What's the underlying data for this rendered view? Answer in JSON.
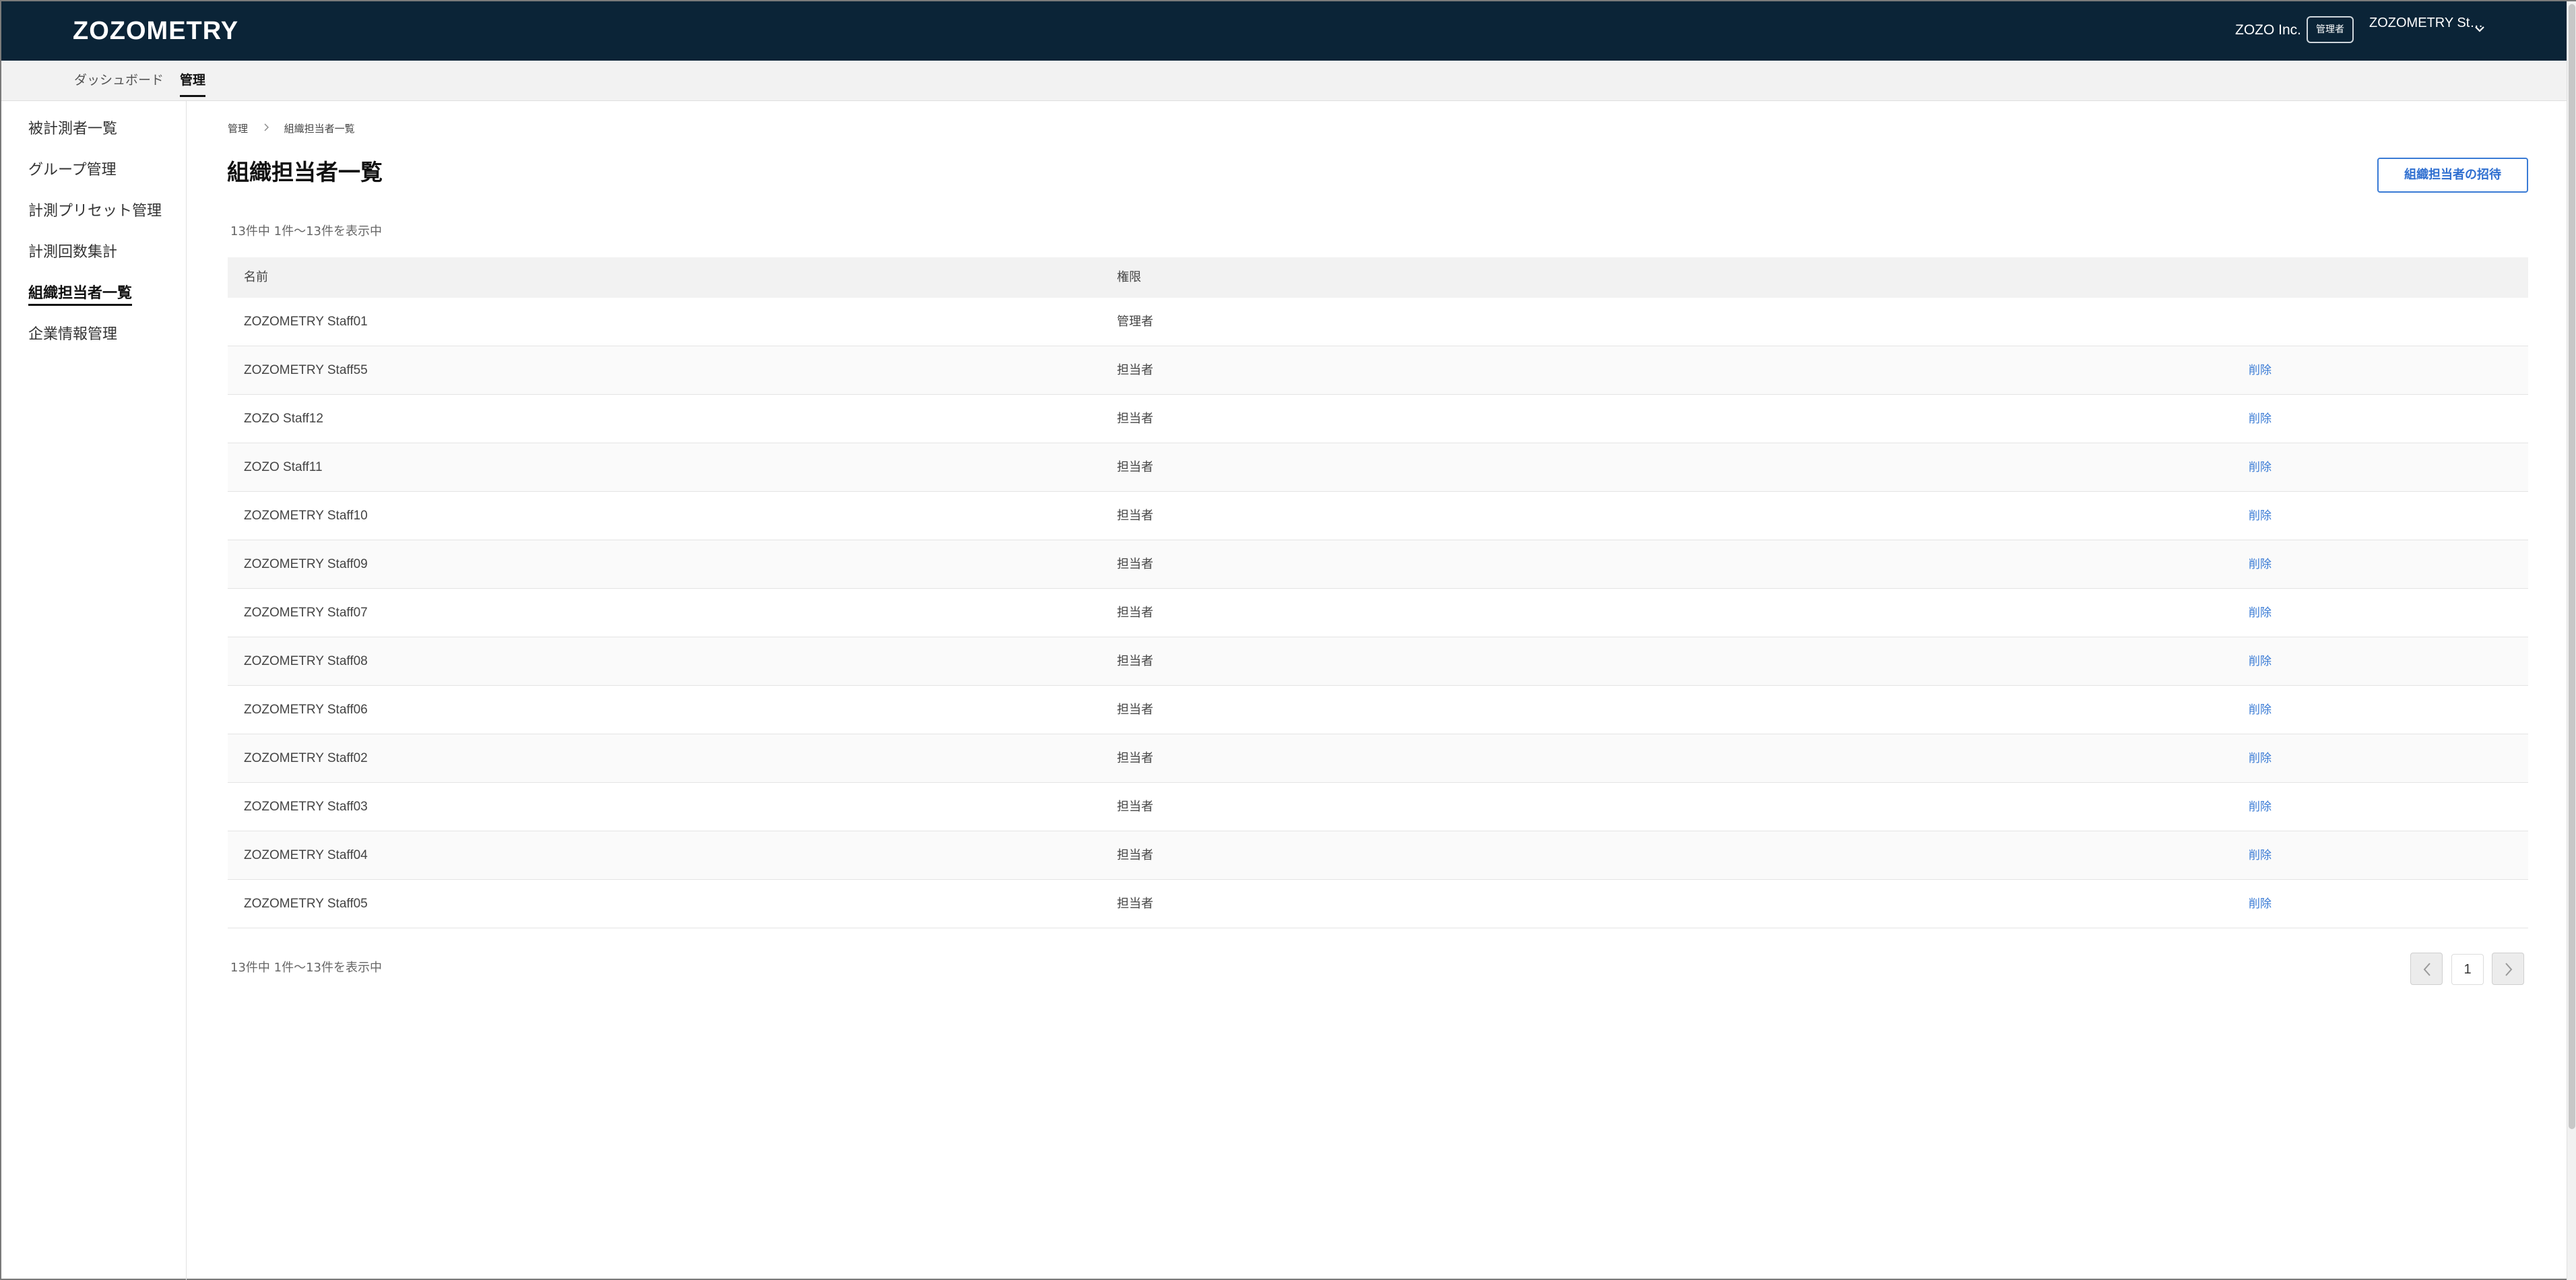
{
  "header": {
    "logo": "ZOZOMETRY",
    "company": "ZOZO Inc.",
    "role_badge": "管理者",
    "user_name": "ZOZOMETRY St…"
  },
  "subnav": {
    "dashboard": "ダッシュボード",
    "admin": "管理"
  },
  "sidebar": {
    "items": [
      {
        "label": "被計測者一覧"
      },
      {
        "label": "グループ管理"
      },
      {
        "label": "計測プリセット管理"
      },
      {
        "label": "計測回数集計"
      },
      {
        "label": "組織担当者一覧",
        "active": true
      },
      {
        "label": "企業情報管理"
      }
    ]
  },
  "breadcrumb": {
    "root": "管理",
    "current": "組織担当者一覧"
  },
  "page": {
    "title": "組織担当者一覧",
    "invite_label": "組織担当者の招待",
    "count_text": "13件中 1件〜13件を表示中"
  },
  "table": {
    "headers": {
      "name": "名前",
      "role": "権限"
    },
    "delete_label": "削除",
    "rows": [
      {
        "name": "ZOZOMETRY Staff01",
        "role": "管理者",
        "deletable": false
      },
      {
        "name": "ZOZOMETRY Staff55",
        "role": "担当者",
        "deletable": true
      },
      {
        "name": "ZOZO Staff12",
        "role": "担当者",
        "deletable": true
      },
      {
        "name": "ZOZO Staff11",
        "role": "担当者",
        "deletable": true
      },
      {
        "name": "ZOZOMETRY Staff10",
        "role": "担当者",
        "deletable": true
      },
      {
        "name": "ZOZOMETRY Staff09",
        "role": "担当者",
        "deletable": true
      },
      {
        "name": "ZOZOMETRY Staff07",
        "role": "担当者",
        "deletable": true
      },
      {
        "name": "ZOZOMETRY Staff08",
        "role": "担当者",
        "deletable": true
      },
      {
        "name": "ZOZOMETRY Staff06",
        "role": "担当者",
        "deletable": true
      },
      {
        "name": "ZOZOMETRY Staff02",
        "role": "担当者",
        "deletable": true
      },
      {
        "name": "ZOZOMETRY Staff03",
        "role": "担当者",
        "deletable": true
      },
      {
        "name": "ZOZOMETRY Staff04",
        "role": "担当者",
        "deletable": true
      },
      {
        "name": "ZOZOMETRY Staff05",
        "role": "担当者",
        "deletable": true
      }
    ]
  },
  "pagination": {
    "current_page": "1"
  },
  "icons": {
    "user_menu": "chevron-down-icon",
    "breadcrumb_separator": "chevron-right-icon",
    "prev_page": "chevron-left-icon",
    "next_page": "chevron-right-icon"
  },
  "colors": {
    "header_bg": "#0b2437",
    "accent": "#3a7bd5",
    "subnav_bg": "#f2f2f2"
  }
}
